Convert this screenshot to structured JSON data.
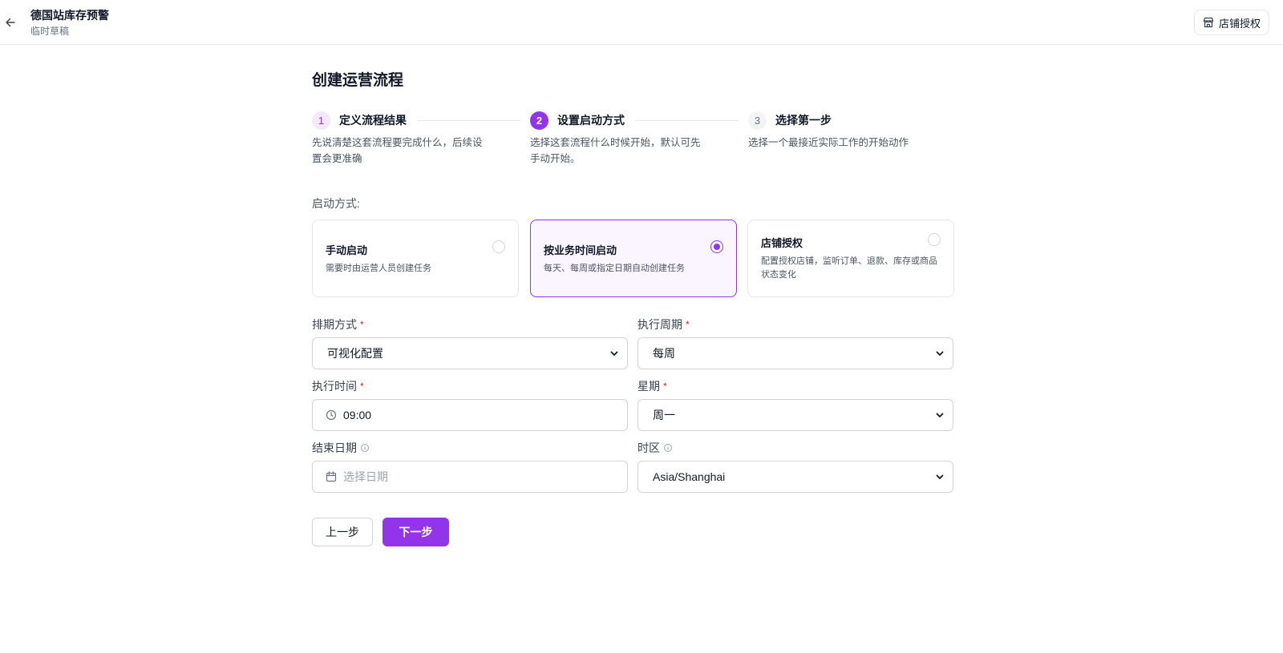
{
  "header": {
    "title": "德国站库存预警",
    "subtitle": "临时草稿",
    "back_icon": "arrow-left-icon",
    "store_auth_button": "店铺授权",
    "store_icon": "store-icon"
  },
  "page_title": "创建运营流程",
  "steps": [
    {
      "number": "1",
      "label": "定义流程结果",
      "description": "先说清楚这套流程要完成什么，后续设置会更准确",
      "state": "done"
    },
    {
      "number": "2",
      "label": "设置启动方式",
      "description": "选择这套流程什么时候开始，默认可先手动开始。",
      "state": "active"
    },
    {
      "number": "3",
      "label": "选择第一步",
      "description": "选择一个最接近实际工作的开始动作",
      "state": "todo"
    }
  ],
  "start_mode": {
    "label": "启动方式:",
    "options": [
      {
        "title": "手动启动",
        "description": "需要时由运营人员创建任务",
        "selected": false
      },
      {
        "title": "按业务时间启动",
        "description": "每天、每周或指定日期自动创建任务",
        "selected": true
      },
      {
        "title": "店铺授权",
        "description": "配置授权店铺，监听订单、退款、库存或商品状态变化",
        "selected": false
      }
    ]
  },
  "form": {
    "schedule_mode": {
      "label": "排期方式",
      "required_mark": "*",
      "value": "可视化配置"
    },
    "period": {
      "label": "执行周期",
      "required_mark": "*",
      "value": "每周"
    },
    "exec_time": {
      "label": "执行时间",
      "required_mark": "*",
      "value": "09:00",
      "icon": "clock-icon"
    },
    "weekday": {
      "label": "星期",
      "required_mark": "*",
      "value": "周一"
    },
    "end_date": {
      "label": "结束日期",
      "placeholder": "选择日期",
      "icon": "calendar-icon"
    },
    "timezone": {
      "label": "时区",
      "value": "Asia/Shanghai"
    }
  },
  "actions": {
    "prev": "上一步",
    "next": "下一步"
  },
  "colors": {
    "accent": "#9333ea",
    "accent_light": "#faf5ff",
    "border": "#e5e7eb",
    "required": "#dc2626"
  }
}
